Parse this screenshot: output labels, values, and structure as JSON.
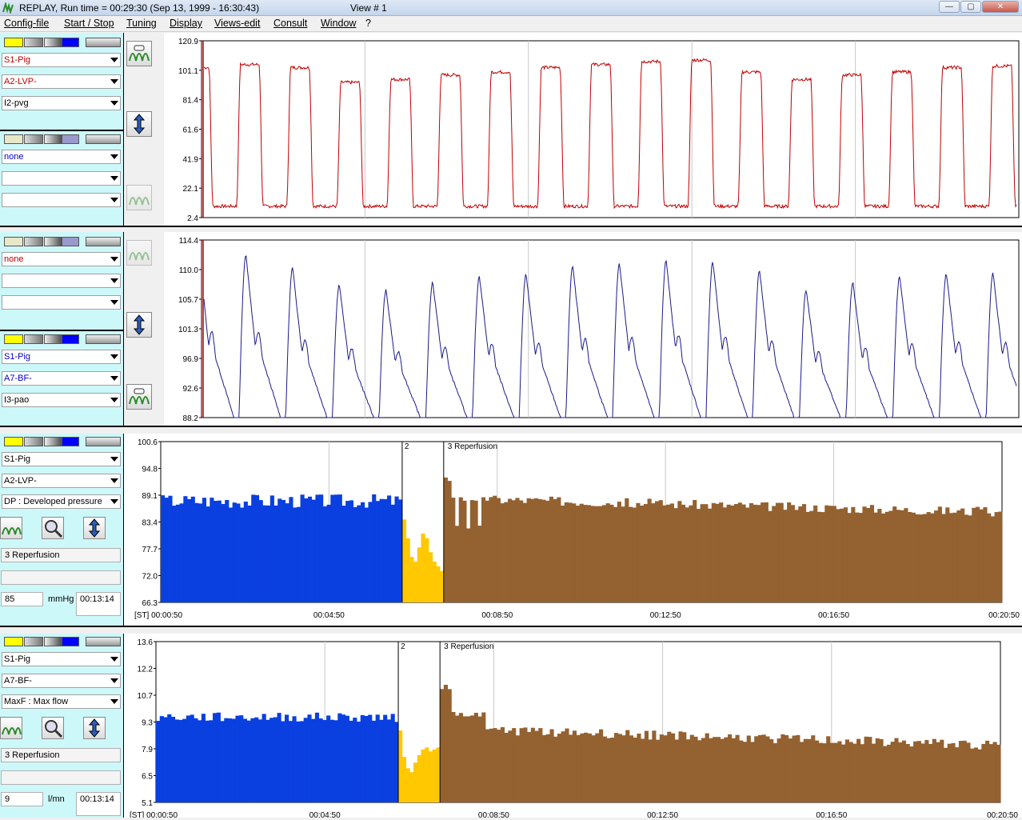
{
  "window": {
    "title": "REPLAY,  Run time = 00:29:30  (Sep 13, 1999 - 16:30:43)",
    "view": "View # 1",
    "min": "—",
    "max": "▢",
    "close": "✕"
  },
  "menu": [
    "Config-file",
    "Start / Stop",
    "Tuning",
    "Display",
    "Views-edit",
    "Consult",
    "Window",
    "?"
  ],
  "panels": [
    {
      "combos": [
        "S1-Pig",
        "A2-LVP-",
        "I2-pvg"
      ],
      "colors": [
        "#c00000",
        "#c00000",
        "#000"
      ]
    },
    {
      "combos": [
        "none",
        "",
        ""
      ],
      "colors": [
        "#0000c0",
        "#000",
        "#000"
      ]
    },
    {
      "combos": [
        "none",
        "",
        ""
      ],
      "colors": [
        "#c00000",
        "#000",
        "#000"
      ]
    },
    {
      "combos": [
        "S1-Pig",
        "A7-BF-",
        "I3-pao"
      ],
      "colors": [
        "#0000c0",
        "#0000c0",
        "#000"
      ]
    },
    {
      "combos": [
        "S1-Pig",
        "A2-LVP-",
        "DP : Developed pressure"
      ],
      "phase": "3 Reperfusion",
      "value": "85",
      "unit": "mmHg",
      "time": "00:13:14"
    },
    {
      "combos": [
        "S1-Pig",
        "A7-BF-",
        "MaxF : Max flow"
      ],
      "phase": "3 Reperfusion",
      "value": "9",
      "unit": "l/mn",
      "time": "00:13:14"
    }
  ],
  "chart_data": [
    {
      "type": "line",
      "yticks": [
        "120.9",
        "101.1",
        "81.4",
        "61.6",
        "41.9",
        "22.1",
        "2.4"
      ],
      "ylim": [
        2.4,
        120.9
      ],
      "color": "#c00000",
      "cycles": 16,
      "low": 10,
      "highs": [
        103,
        105,
        103,
        93,
        95,
        98,
        100,
        103,
        105,
        107,
        108,
        100,
        95,
        98,
        100,
        103,
        104,
        102
      ],
      "grid": true
    },
    {
      "type": "line",
      "yticks": [
        "114.4",
        "110.0",
        "105.7",
        "101.3",
        "96.9",
        "92.6",
        "88.2"
      ],
      "ylim": [
        88.2,
        114.4
      ],
      "color": "#1a1a8a",
      "peaks": [
        112.5,
        112.3,
        110.3,
        107.8,
        107.0,
        108.2,
        109.1,
        109.4,
        110.5,
        111.0,
        111.4,
        111.2,
        109.9,
        107.0,
        108.1,
        109.1,
        109.5,
        109.5
      ],
      "grid": true
    },
    {
      "type": "bar",
      "yticks": [
        "100.6",
        "94.8",
        "89.1",
        "83.4",
        "77.7",
        "72.0",
        "66.3"
      ],
      "ylim": [
        66.3,
        100.6
      ],
      "xticks": [
        "[ST] 00:00:50",
        "00:04:50",
        "00:08:50",
        "00:12:50",
        "00:16:50",
        "00:20:50"
      ],
      "markers": [
        "2",
        "3 Reperfusion"
      ],
      "phases": [
        {
          "color": "#0a3fe0",
          "n": 64,
          "base": 88,
          "noise": 1.5
        },
        {
          "color": "#ffc800",
          "values": [
            84,
            80,
            76,
            75,
            78,
            81,
            80,
            77,
            75,
            74,
            73
          ]
        },
        {
          "color": "#946130",
          "n": 148,
          "base": 88.5,
          "noise": 1.0
        }
      ]
    },
    {
      "type": "bar",
      "yticks": [
        "13.6",
        "12.2",
        "10.7",
        "9.3",
        "7.9",
        "6.5",
        "5.1"
      ],
      "ylim": [
        5.1,
        13.6
      ],
      "xticks": [
        "[ST] 00:00:50",
        "00:04:50",
        "00:08:50",
        "00:12:50",
        "00:16:50",
        "00:20:50"
      ],
      "markers": [
        "2",
        "3 Reperfusion"
      ],
      "phases": [
        {
          "color": "#0a3fe0",
          "n": 64,
          "base": 9.6,
          "noise": 0.25
        },
        {
          "color": "#ffc800",
          "values": [
            8.9,
            7.5,
            6.9,
            6.7,
            7.2,
            7.6,
            7.9,
            8.0,
            7.8,
            7.9,
            8.0
          ]
        },
        {
          "color": "#946130",
          "n": 148,
          "base": 9.0,
          "noise": 0.25
        }
      ]
    }
  ]
}
